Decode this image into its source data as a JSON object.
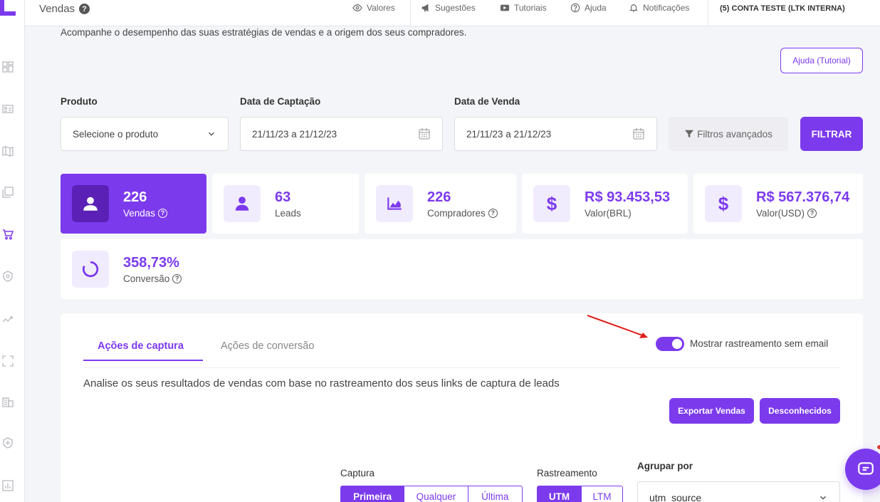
{
  "header": {
    "title": "Vendas",
    "help_glyph": "?",
    "nav": [
      {
        "label": "Valores",
        "icon": "eye-icon"
      },
      {
        "label": "Sugestões",
        "icon": "megaphone-icon"
      },
      {
        "label": "Tutoriais",
        "icon": "video-icon"
      },
      {
        "label": "Ajuda",
        "icon": "help-icon"
      },
      {
        "label": "Notificações",
        "icon": "bell-icon"
      }
    ],
    "account": "(5) CONTA TESTE (LTK INTERNA)"
  },
  "subtitle": "Acompanhe o desempenho das suas estratégias de vendas e a origem dos seus compradores.",
  "help_button": "Ajuda (Tutorial)",
  "filters": {
    "produto_label": "Produto",
    "produto_placeholder": "Selecione o produto",
    "captacao_label": "Data de Captação",
    "captacao_value": "21/11/23 a 21/12/23",
    "venda_label": "Data de Venda",
    "venda_value": "21/11/23 a 21/12/23",
    "advanced_label": "Filtros avançados",
    "filter_button": "FILTRAR"
  },
  "stats": [
    {
      "value": "226",
      "label": "Vendas",
      "icon": "user-icon",
      "help": true,
      "active": true
    },
    {
      "value": "63",
      "label": "Leads",
      "icon": "person-icon",
      "help": false,
      "active": false
    },
    {
      "value": "226",
      "label": "Compradores",
      "icon": "area-chart-icon",
      "help": true,
      "active": false
    },
    {
      "value": "R$ 93.453,53",
      "label": "Valor(BRL)",
      "icon": "dollar-icon",
      "help": false,
      "active": false
    },
    {
      "value": "R$ 567.376,74",
      "label": "Valor(USD)",
      "icon": "dollar-icon",
      "help": true,
      "active": false
    },
    {
      "value": "358,73%",
      "label": "Conversão",
      "icon": "ring-icon",
      "help": true,
      "active": false
    }
  ],
  "panel": {
    "tabs": [
      "Ações de captura",
      "Ações de conversão"
    ],
    "toggle_label": "Mostrar rastreamento sem email",
    "toggle_on": true,
    "description": "Analise os seus resultados de vendas com base no rastreamento dos seus links de captura de leads",
    "export_button": "Exportar Vendas",
    "unknown_button": "Desconhecidos",
    "captura_label": "Captura",
    "captura_options": [
      "Primeira",
      "Qualquer",
      "Última"
    ],
    "rastreamento_label": "Rastreamento",
    "rastreamento_options": [
      "UTM",
      "LTM"
    ],
    "agrupar_label": "Agrupar por",
    "agrupar_value": "utm_source"
  },
  "colors": {
    "accent": "#7c3aed",
    "background": "#f4f5f8"
  }
}
